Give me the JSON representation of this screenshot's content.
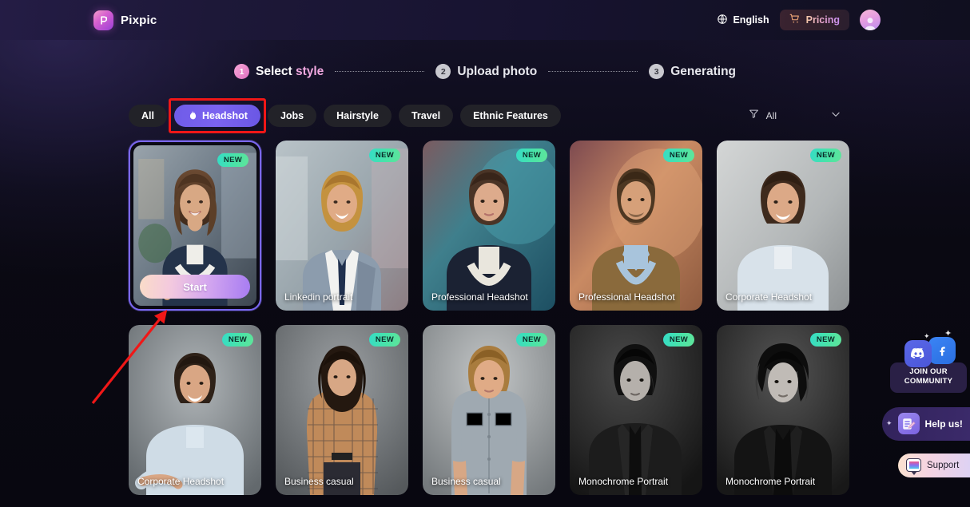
{
  "header": {
    "brand_name": "Pixpic",
    "logo_icon": "pixpic-logo-icon",
    "language": {
      "label": "English",
      "icon": "globe-icon"
    },
    "pricing": {
      "label": "Pricing",
      "icon": "cart-icon"
    },
    "avatar": {
      "icon": "user-avatar-icon"
    }
  },
  "steps": [
    {
      "number": "1",
      "label_main": "Select ",
      "label_accent": "style",
      "state": "active"
    },
    {
      "number": "2",
      "label_main": "Upload photo",
      "label_accent": "",
      "state": "idle"
    },
    {
      "number": "3",
      "label_main": "Generating",
      "label_accent": "",
      "state": "idle"
    }
  ],
  "filters": {
    "chips": [
      {
        "label": "All",
        "active": false,
        "icon": ""
      },
      {
        "label": "Headshot",
        "active": true,
        "icon": "fire-icon",
        "highlighted": true
      },
      {
        "label": "Jobs",
        "active": false,
        "icon": ""
      },
      {
        "label": "Hairstyle",
        "active": false,
        "icon": ""
      },
      {
        "label": "Travel",
        "active": false,
        "icon": ""
      },
      {
        "label": "Ethnic Features",
        "active": false,
        "icon": ""
      }
    ],
    "sort": {
      "icon": "filter-funnel-icon",
      "label": "All",
      "chevron": "chevron-down-icon"
    }
  },
  "cards": [
    {
      "label": "",
      "badge": "NEW",
      "selected": true,
      "start_label": "Start",
      "theme": "office-warm"
    },
    {
      "label": "Linkedin portrait",
      "badge": "NEW",
      "selected": false,
      "theme": "office-cool"
    },
    {
      "label": "Professional Headshot",
      "badge": "NEW",
      "selected": false,
      "theme": "teal"
    },
    {
      "label": "Professional Headshot",
      "badge": "NEW",
      "selected": false,
      "theme": "warm-orange"
    },
    {
      "label": "Corporate Headshot",
      "badge": "NEW",
      "selected": false,
      "theme": "light-grey"
    },
    {
      "label": "Corporate Headshot",
      "badge": "NEW",
      "selected": false,
      "theme": "grey"
    },
    {
      "label": "Business casual",
      "badge": "NEW",
      "selected": false,
      "theme": "grey"
    },
    {
      "label": "Business casual",
      "badge": "NEW",
      "selected": false,
      "theme": "light-grey"
    },
    {
      "label": "Monochrome Portrait",
      "badge": "NEW",
      "selected": false,
      "theme": "mono"
    },
    {
      "label": "Monochrome Portrait",
      "badge": "NEW",
      "selected": false,
      "theme": "mono"
    }
  ],
  "floaters": {
    "community": {
      "line1": "JOIN OUR",
      "line2": "COMMUNITY",
      "icons": [
        "discord-icon",
        "facebook-icon"
      ]
    },
    "help": {
      "label": "Help us!",
      "icon": "feedback-pencil-icon"
    },
    "support": {
      "label": "Support",
      "icon": "chat-bubble-icon"
    }
  },
  "colors": {
    "accent_purple": "#7b68f0",
    "accent_pink": "#f0a8e0",
    "badge_green": "#49e3a8",
    "annotation_red": "#f01717",
    "background": "#08070d"
  }
}
